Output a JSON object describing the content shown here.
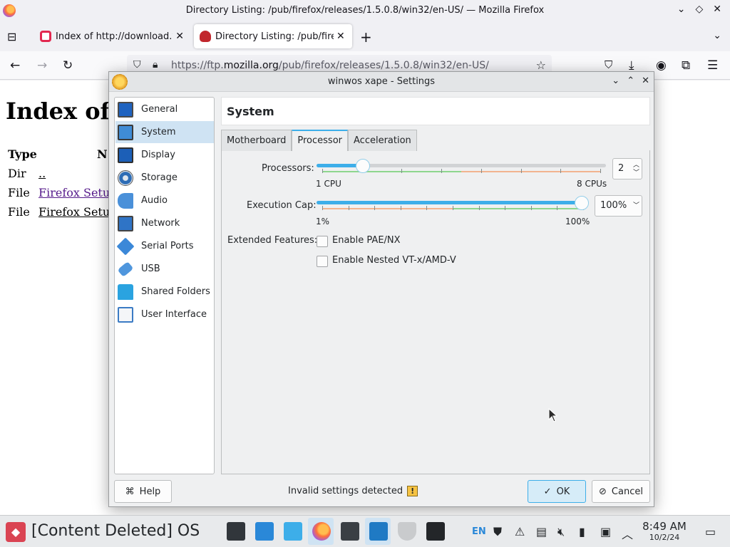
{
  "firefox": {
    "window_title": "Directory Listing: /pub/firefox/releases/1.5.0.8/win32/en-US/ — Mozilla Firefox",
    "tabs": [
      {
        "label": "Index of http://download.v"
      },
      {
        "label": "Directory Listing: /pub/firef"
      }
    ],
    "url_prefix": "https://ftp.",
    "url_host": "mozilla.org",
    "url_path": "/pub/firefox/releases/1.5.0.8/win32/en-US/"
  },
  "page": {
    "heading": "Index of",
    "col_type": "Type",
    "col_name": "N",
    "rows": [
      {
        "type": "Dir",
        "name": ".."
      },
      {
        "type": "File",
        "name": "Firefox Setup"
      },
      {
        "type": "File",
        "name": "Firefox Setup"
      }
    ]
  },
  "dialog": {
    "title": "winwos xape - Settings",
    "categories": [
      {
        "label": "General",
        "icon": "general-icon"
      },
      {
        "label": "System",
        "icon": "system-icon",
        "active": true
      },
      {
        "label": "Display",
        "icon": "display-icon"
      },
      {
        "label": "Storage",
        "icon": "storage-icon"
      },
      {
        "label": "Audio",
        "icon": "audio-icon"
      },
      {
        "label": "Network",
        "icon": "network-icon"
      },
      {
        "label": "Serial Ports",
        "icon": "serial-port-icon"
      },
      {
        "label": "USB",
        "icon": "usb-icon"
      },
      {
        "label": "Shared Folders",
        "icon": "shared-folder-icon"
      },
      {
        "label": "User Interface",
        "icon": "user-interface-icon"
      }
    ],
    "section_title": "System",
    "tabs": [
      {
        "label": "Motherboard"
      },
      {
        "label": "Processor",
        "active": true
      },
      {
        "label": "Acceleration"
      }
    ],
    "processor": {
      "processors_label": "Processors:",
      "processors_value": "2",
      "processors_min": 1,
      "processors_max": 8,
      "processors_current": 2,
      "cpu_min_label": "1 CPU",
      "cpu_max_label": "8 CPUs",
      "exec_cap_label": "Execution Cap:",
      "exec_cap_value": "100%",
      "exec_cap_current": 100,
      "cap_min_label": "1%",
      "cap_max_label": "100%",
      "extended_label": "Extended Features:",
      "pae_label": "Enable PAE/NX",
      "pae_checked": false,
      "nested_label": "Enable Nested VT-x/AMD-V",
      "nested_checked": false
    },
    "help_label": "Help",
    "status_text": "Invalid settings detected",
    "ok_label": "OK",
    "cancel_label": "Cancel"
  },
  "taskbar": {
    "start_label": "[Content Deleted] OS",
    "keyboard_layout": "EN",
    "time": "8:49 AM",
    "date": "10/2/24"
  },
  "colors": {
    "accent": "#3daee9",
    "selection": "#cfe3f3",
    "warning": "#f6c343"
  }
}
